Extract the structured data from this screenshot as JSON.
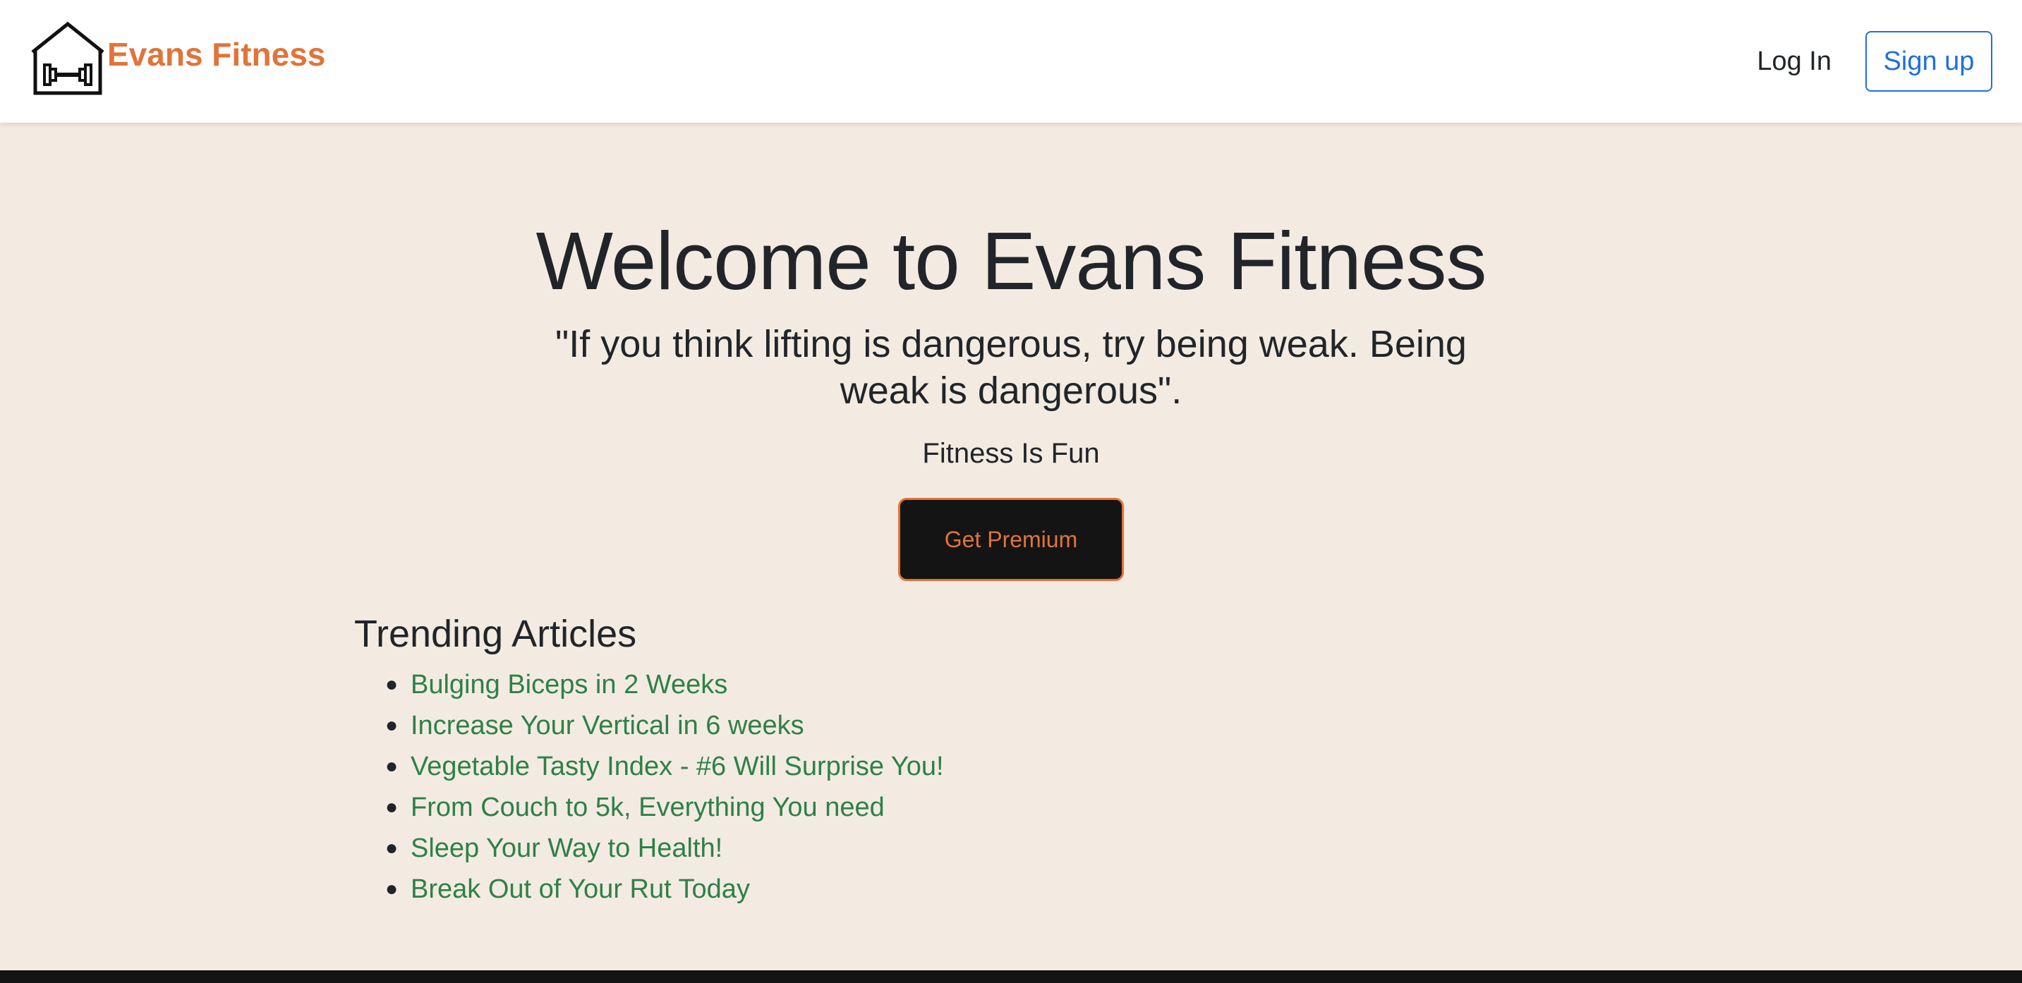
{
  "navbar": {
    "brand_name": "Evans Fitness",
    "logo_icon": "house-dumbbell-icon",
    "login_label": "Log In",
    "signup_label": "Sign up"
  },
  "hero": {
    "title": "Welcome to Evans Fitness",
    "quote": "\"If you think lifting is dangerous, try being weak. Being weak is dangerous\".",
    "tagline": "Fitness Is Fun",
    "premium_label": "Get Premium"
  },
  "articles": {
    "title": "Trending Articles",
    "items": [
      {
        "label": "Bulging Biceps in 2 Weeks"
      },
      {
        "label": "Increase Your Vertical in 6 weeks"
      },
      {
        "label": "Vegetable Tasty Index - #6 Will Surprise You!"
      },
      {
        "label": "From Couch to 5k, Everything You need"
      },
      {
        "label": "Sleep Your Way to Health!"
      },
      {
        "label": "Break Out of Your Rut Today"
      }
    ]
  },
  "colors": {
    "brand_orange": "#e0743a",
    "link_green": "#2e8048",
    "signup_blue": "#1f6fde",
    "page_bg": "#f3ebe1",
    "dark": "#141414"
  }
}
